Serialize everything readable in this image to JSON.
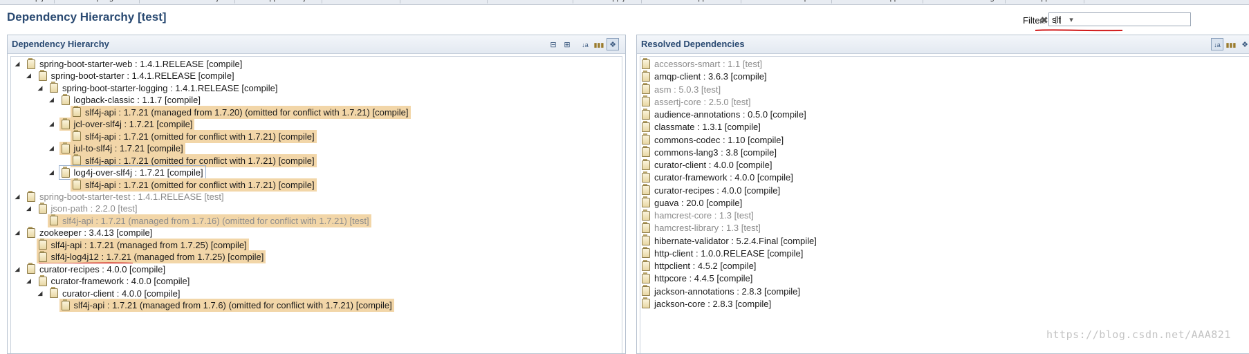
{
  "tabs": [
    "Bootstrap.j...",
    "springboot...",
    "RabbitTest.java",
    "Application.java",
    "CuratorTest...",
    "DistributedL...",
    "DistributedL...",
    "App.java",
    "Application...",
    "ZookeeperC...",
    "DemoApplicat...",
    "RabbitConfig...",
    "Application..."
  ],
  "page_title": "Dependency Hierarchy [test]",
  "filter": {
    "label": "Filter:",
    "value": "slf"
  },
  "header_buttons": {
    "clear": "✖",
    "expand": "[ ]",
    "menu": "▾"
  },
  "colors": {
    "highlight": "#f2d6a8",
    "title": "#2a4a72",
    "annotation_red": "#d11a1a"
  },
  "left_panel": {
    "title": "Dependency Hierarchy",
    "toolbar": [
      "collapse-all-icon",
      "expand-all-icon",
      "sort-icon",
      "show-groupid-icon",
      "filter-toggle-icon"
    ],
    "rows": [
      {
        "text": "spring-boot-starter-web : 1.4.1.RELEASE [compile]",
        "level": 0,
        "twisty": "expanded",
        "hl": false,
        "grey": false
      },
      {
        "text": "spring-boot-starter : 1.4.1.RELEASE [compile]",
        "level": 1,
        "twisty": "expanded",
        "hl": false,
        "grey": false
      },
      {
        "text": "spring-boot-starter-logging : 1.4.1.RELEASE [compile]",
        "level": 2,
        "twisty": "expanded",
        "hl": false,
        "grey": false
      },
      {
        "text": "logback-classic : 1.1.7 [compile]",
        "level": 3,
        "twisty": "expanded",
        "hl": false,
        "grey": false
      },
      {
        "text": "slf4j-api : 1.7.21 (managed from 1.7.20) (omitted for conflict with 1.7.21) [compile]",
        "level": 4,
        "twisty": "none",
        "hl": true,
        "grey": false
      },
      {
        "text": "jcl-over-slf4j : 1.7.21 [compile]",
        "level": 3,
        "twisty": "expanded",
        "hl": true,
        "grey": false
      },
      {
        "text": "slf4j-api : 1.7.21 (omitted for conflict with 1.7.21) [compile]",
        "level": 4,
        "twisty": "none",
        "hl": true,
        "grey": false
      },
      {
        "text": "jul-to-slf4j : 1.7.21 [compile]",
        "level": 3,
        "twisty": "expanded",
        "hl": true,
        "grey": false
      },
      {
        "text": "slf4j-api : 1.7.21 (omitted for conflict with 1.7.21) [compile]",
        "level": 4,
        "twisty": "none",
        "hl": true,
        "grey": false
      },
      {
        "text": "log4j-over-slf4j : 1.7.21 [compile]",
        "level": 3,
        "twisty": "expanded",
        "hl": false,
        "grey": false,
        "boxed": true
      },
      {
        "text": "slf4j-api : 1.7.21 (omitted for conflict with 1.7.21) [compile]",
        "level": 4,
        "twisty": "none",
        "hl": true,
        "grey": false
      },
      {
        "text": "spring-boot-starter-test : 1.4.1.RELEASE [test]",
        "level": 0,
        "twisty": "expanded",
        "hl": false,
        "grey": true
      },
      {
        "text": "json-path : 2.2.0 [test]",
        "level": 1,
        "twisty": "expanded",
        "hl": false,
        "grey": true
      },
      {
        "text": "slf4j-api : 1.7.21 (managed from 1.7.16) (omitted for conflict with 1.7.21) [test]",
        "level": 2,
        "twisty": "none",
        "hl": true,
        "grey": true
      },
      {
        "text": "zookeeper : 3.4.13 [compile]",
        "level": 0,
        "twisty": "expanded",
        "hl": false,
        "grey": false
      },
      {
        "text": "slf4j-api : 1.7.21 (managed from 1.7.25) [compile]",
        "level": 1,
        "twisty": "none",
        "hl": true,
        "grey": false
      },
      {
        "text": "slf4j-log4j12 : 1.7.21 (managed from 1.7.25) [compile]",
        "level": 1,
        "twisty": "none",
        "hl": true,
        "grey": false
      },
      {
        "text": "curator-recipes : 4.0.0 [compile]",
        "level": 0,
        "twisty": "expanded",
        "hl": false,
        "grey": false
      },
      {
        "text": "curator-framework : 4.0.0 [compile]",
        "level": 1,
        "twisty": "expanded",
        "hl": false,
        "grey": false
      },
      {
        "text": "curator-client : 4.0.0 [compile]",
        "level": 2,
        "twisty": "expanded",
        "hl": false,
        "grey": false
      },
      {
        "text": "slf4j-api : 1.7.21 (managed from 1.7.6) (omitted for conflict with 1.7.21) [compile]",
        "level": 3,
        "twisty": "none",
        "hl": true,
        "grey": false
      }
    ]
  },
  "right_panel": {
    "title": "Resolved Dependencies",
    "toolbar": [
      "sort-icon",
      "show-groupid-icon",
      "filter-toggle-icon"
    ],
    "rows": [
      {
        "text": "accessors-smart : 1.1 [test]",
        "grey": true
      },
      {
        "text": "amqp-client : 3.6.3 [compile]",
        "grey": false
      },
      {
        "text": "asm : 5.0.3 [test]",
        "grey": true
      },
      {
        "text": "assertj-core : 2.5.0 [test]",
        "grey": true
      },
      {
        "text": "audience-annotations : 0.5.0 [compile]",
        "grey": false
      },
      {
        "text": "classmate : 1.3.1 [compile]",
        "grey": false
      },
      {
        "text": "commons-codec : 1.10 [compile]",
        "grey": false
      },
      {
        "text": "commons-lang3 : 3.8 [compile]",
        "grey": false
      },
      {
        "text": "curator-client : 4.0.0 [compile]",
        "grey": false
      },
      {
        "text": "curator-framework : 4.0.0 [compile]",
        "grey": false
      },
      {
        "text": "curator-recipes : 4.0.0 [compile]",
        "grey": false
      },
      {
        "text": "guava : 20.0 [compile]",
        "grey": false
      },
      {
        "text": "hamcrest-core : 1.3 [test]",
        "grey": true
      },
      {
        "text": "hamcrest-library : 1.3 [test]",
        "grey": true
      },
      {
        "text": "hibernate-validator : 5.2.4.Final [compile]",
        "grey": false
      },
      {
        "text": "http-client : 1.0.0.RELEASE [compile]",
        "grey": false
      },
      {
        "text": "httpclient : 4.5.2 [compile]",
        "grey": false
      },
      {
        "text": "httpcore : 4.4.5 [compile]",
        "grey": false
      },
      {
        "text": "jackson-annotations : 2.8.3 [compile]",
        "grey": false
      },
      {
        "text": "jackson-core : 2.8.3 [compile]",
        "grey": false
      }
    ]
  },
  "watermark": "https://blog.csdn.net/AAA821"
}
